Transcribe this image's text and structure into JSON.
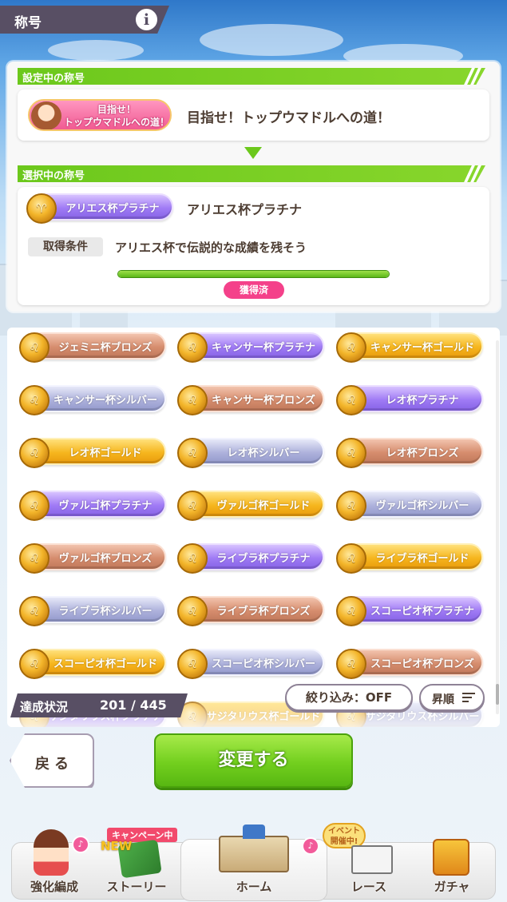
{
  "header": {
    "title": "称号",
    "info_glyph": "i"
  },
  "current_section": {
    "heading": "設定中の称号",
    "badge_line1": "目指せ！",
    "badge_line2": "トップウマドルへの道！",
    "name": "目指せ！トップウマドルへの道！"
  },
  "selected_section": {
    "heading": "選択中の称号",
    "badge_label": "アリエス杯プラチナ",
    "name": "アリエス杯プラチナ",
    "condition_label": "取得条件",
    "condition_text": "アリエス杯で伝説的な成績を残そう",
    "progress": 1.0,
    "status_label": "獲得済"
  },
  "titles": [
    {
      "label": "ジェミニ杯ブロンズ",
      "tier": "bronze"
    },
    {
      "label": "キャンサー杯プラチナ",
      "tier": "platinum"
    },
    {
      "label": "キャンサー杯ゴールド",
      "tier": "gold"
    },
    {
      "label": "キャンサー杯シルバー",
      "tier": "silver"
    },
    {
      "label": "キャンサー杯ブロンズ",
      "tier": "bronze"
    },
    {
      "label": "レオ杯プラチナ",
      "tier": "platinum"
    },
    {
      "label": "レオ杯ゴールド",
      "tier": "gold"
    },
    {
      "label": "レオ杯シルバー",
      "tier": "silver"
    },
    {
      "label": "レオ杯ブロンズ",
      "tier": "bronze"
    },
    {
      "label": "ヴァルゴ杯プラチナ",
      "tier": "platinum"
    },
    {
      "label": "ヴァルゴ杯ゴールド",
      "tier": "gold"
    },
    {
      "label": "ヴァルゴ杯シルバー",
      "tier": "silver"
    },
    {
      "label": "ヴァルゴ杯ブロンズ",
      "tier": "bronze"
    },
    {
      "label": "ライブラ杯プラチナ",
      "tier": "platinum"
    },
    {
      "label": "ライブラ杯ゴールド",
      "tier": "gold"
    },
    {
      "label": "ライブラ杯シルバー",
      "tier": "silver"
    },
    {
      "label": "ライブラ杯ブロンズ",
      "tier": "bronze"
    },
    {
      "label": "スコーピオ杯プラチナ",
      "tier": "platinum"
    },
    {
      "label": "スコーピオ杯ゴールド",
      "tier": "gold"
    },
    {
      "label": "スコーピオ杯シルバー",
      "tier": "silver"
    },
    {
      "label": "スコーピオ杯ブロンズ",
      "tier": "bronze"
    },
    {
      "label": "サジタリウス杯プラチナ",
      "tier": "platinum"
    },
    {
      "label": "サジタリウス杯ゴールド",
      "tier": "gold"
    },
    {
      "label": "サジタリウス杯シルバー",
      "tier": "silver"
    }
  ],
  "list_status": {
    "label": "達成状況",
    "value": "201 / 445"
  },
  "filter_button": "絞り込み：OFF",
  "sort_button": "昇順",
  "back_button": "戻る",
  "change_button": "変更する",
  "nav": {
    "items": [
      "強化編成",
      "ストーリー",
      "ホーム",
      "レース",
      "ガチャ"
    ],
    "campaign_tag": "キャンペーン中",
    "new_tag": "NEW",
    "event_tag_line1": "イベント",
    "event_tag_line2": "開催中!"
  },
  "colors": {
    "accent_green": "#6cc81c",
    "header_bg": "#584f64",
    "pink": "#f4418a"
  }
}
